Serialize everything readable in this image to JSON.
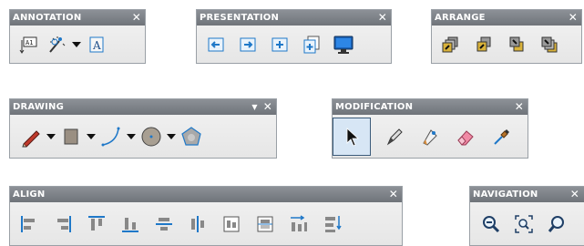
{
  "toolbars": {
    "annotation": {
      "title": "ANNOTATION",
      "close": "✕"
    },
    "presentation": {
      "title": "PRESENTATION",
      "close": "✕"
    },
    "arrange": {
      "title": "ARRANGE",
      "close": "✕"
    },
    "drawing": {
      "title": "DRAWING",
      "pin": "▼",
      "close": "✕"
    },
    "modification": {
      "title": "MODIFICATION",
      "close": "✕"
    },
    "align": {
      "title": "ALIGN",
      "close": "✕"
    },
    "navigation": {
      "title": "NAVIGATION",
      "close": "✕"
    }
  },
  "icons": {
    "annotation": [
      "text-box-icon",
      "magic-wand-icon",
      "dropdown-arrow-icon",
      "text-frame-icon"
    ],
    "presentation": [
      "arrow-left-icon",
      "arrow-right-icon",
      "add-slide-icon",
      "new-page-icon",
      "monitor-icon"
    ],
    "arrange": [
      "bring-to-front-icon",
      "bring-forward-icon",
      "send-backward-icon",
      "send-to-back-icon"
    ],
    "drawing": [
      "pencil-icon",
      "rectangle-icon",
      "arc-icon",
      "circle-icon",
      "polygon-icon"
    ],
    "modification": [
      "pointer-icon",
      "pen-icon",
      "fill-icon",
      "eraser-icon",
      "eyedropper-icon"
    ],
    "align": [
      "align-left-icon",
      "align-right-icon",
      "align-top-icon",
      "align-bottom-icon",
      "align-center-horizontal-icon",
      "align-center-vertical-icon",
      "distribute-horizontal-icon",
      "distribute-vertical-icon",
      "space-horizontal-icon",
      "space-vertical-icon"
    ],
    "navigation": [
      "zoom-out-icon",
      "zoom-fit-icon",
      "zoom-in-icon"
    ]
  },
  "colors": {
    "titlebar": "#7d8288",
    "icon_blue": "#1f78c8",
    "icon_gold": "#d9b23a",
    "pencil_red": "#c0392b",
    "eraser_pink": "#f08aa5"
  }
}
